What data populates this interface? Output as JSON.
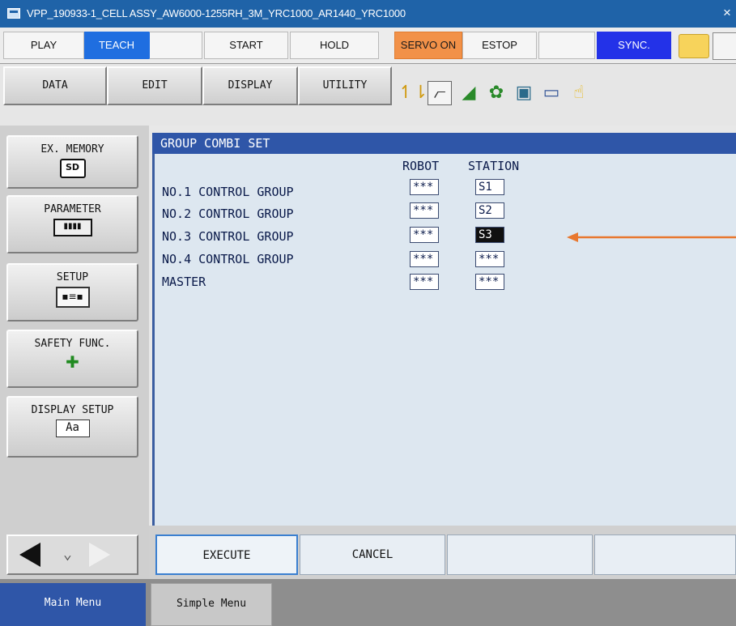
{
  "window": {
    "title": "VPP_190933-1_CELL ASSY_AW6000-1255RH_3M_YRC1000_AR1440_YRC1000",
    "close": "×"
  },
  "statusbar": {
    "play": "PLAY",
    "teach": "TEACH",
    "start": "START",
    "hold": "HOLD",
    "servo_on": "SERVO ON",
    "estop": "ESTOP",
    "sync": "SYNC."
  },
  "menubar": {
    "data": "DATA",
    "edit": "EDIT",
    "display": "DISPLAY",
    "utility": "UTILITY"
  },
  "sidebar": {
    "items": [
      {
        "label": "EX. MEMORY",
        "icon": "sd-card-icon",
        "glyph": "SD"
      },
      {
        "label": "PARAMETER",
        "icon": "parameter-hand-icon",
        "glyph": "▮▮▮▮"
      },
      {
        "label": "SETUP",
        "icon": "setup-icon",
        "glyph": "▪≡▪"
      },
      {
        "label": "SAFETY FUNC.",
        "icon": "safety-plus-icon",
        "glyph": "✚"
      },
      {
        "label": "DISPLAY SETUP",
        "icon": "display-setup-icon",
        "glyph": "Aa"
      }
    ]
  },
  "panel": {
    "title": "GROUP COMBI SET",
    "col_robot": "ROBOT",
    "col_station": "STATION",
    "rows": [
      {
        "label": "NO.1 CONTROL GROUP",
        "robot": "***",
        "station": "S1"
      },
      {
        "label": "NO.2 CONTROL GROUP",
        "robot": "***",
        "station": "S2"
      },
      {
        "label": "NO.3 CONTROL GROUP",
        "robot": "***",
        "station": "S3"
      },
      {
        "label": "NO.4 CONTROL GROUP",
        "robot": "***",
        "station": "***"
      },
      {
        "label": "MASTER",
        "robot": "***",
        "station": "***"
      }
    ],
    "annotation_color": "#e8782f"
  },
  "bottom": {
    "execute": "EXECUTE",
    "cancel": "CANCEL"
  },
  "footer": {
    "main_menu": "Main Menu",
    "simple_menu": "Simple Menu"
  }
}
